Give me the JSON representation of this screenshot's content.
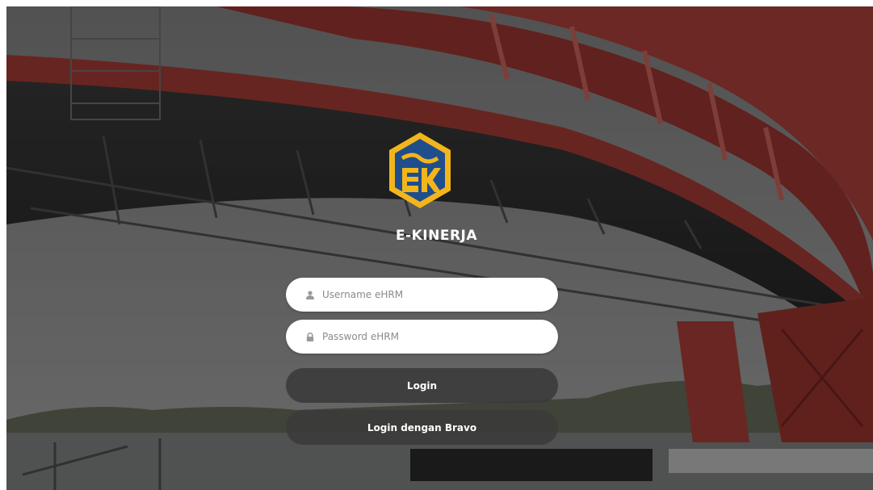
{
  "app": {
    "title": "E-KINERJA",
    "logo_text": "EK"
  },
  "form": {
    "username": {
      "placeholder": "Username eHRM",
      "value": "",
      "icon": "user-icon"
    },
    "password": {
      "placeholder": "Password eHRM",
      "value": "",
      "icon": "lock-icon"
    },
    "login_label": "Login",
    "bravo_label": "Login dengan Bravo"
  },
  "colors": {
    "logo_gold": "#f2b51b",
    "logo_blue": "#1f4e8c",
    "button_bg": "#3a3a3a",
    "bridge_red": "#c8322f"
  }
}
